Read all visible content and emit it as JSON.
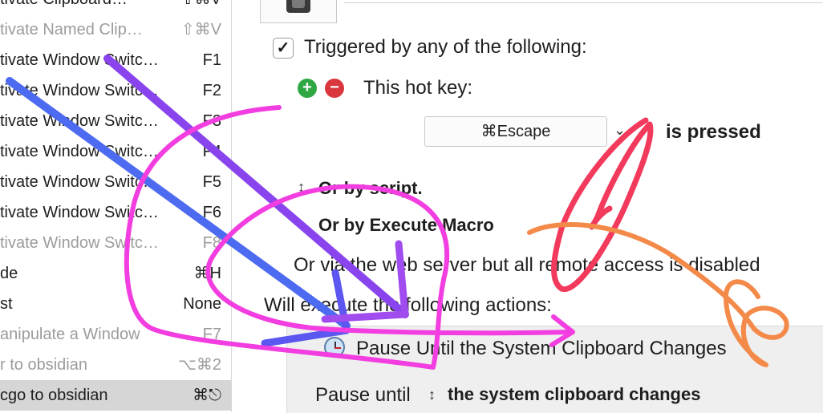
{
  "macro_list": {
    "items": [
      {
        "name": "tivate Clipboard…",
        "key": "⇧⌘V",
        "disabled": false
      },
      {
        "name": "tivate Named Clip…",
        "key": "⇧⌘V",
        "disabled": true
      },
      {
        "name": "tivate Window Switc…",
        "key": "F1",
        "disabled": false
      },
      {
        "name": "tivate Window Switc…",
        "key": "F2",
        "disabled": false
      },
      {
        "name": "tivate Window Switc…",
        "key": "F3",
        "disabled": false
      },
      {
        "name": "tivate Window Switc…",
        "key": "F4",
        "disabled": false
      },
      {
        "name": "tivate Window Switc…",
        "key": "F5",
        "disabled": false
      },
      {
        "name": "tivate Window Switc…",
        "key": "F6",
        "disabled": false
      },
      {
        "name": "tivate Window Switc…",
        "key": "F8",
        "disabled": true
      },
      {
        "name": "de",
        "key": "⌘H",
        "disabled": false
      },
      {
        "name": "st",
        "key": "None",
        "disabled": false
      },
      {
        "name": "anipulate a Window",
        "key": "F7",
        "disabled": true
      },
      {
        "name": "r to  obsidian",
        "key": "⌥⌘2",
        "disabled": true
      },
      {
        "name": "cgo to  obsidian",
        "key": "⌘⎋",
        "disabled": false,
        "selected": true
      }
    ]
  },
  "trigger": {
    "checkbox_checked": "✓",
    "label": "Triggered by any of the following:",
    "add_icon": "plus-circle-icon",
    "remove_icon": "minus-circle-icon",
    "hotkey_label": "This hot key:",
    "hotkey_value": "⌘Escape",
    "pressed_label": "is pressed",
    "or_script": "Or by script.",
    "or_execute_macro": "Or by Execute Macro",
    "web_server": "Or via the web server but all remote access is disabled"
  },
  "actions": {
    "heading": "Will execute the following actions:",
    "action_title": "Pause Until the System Clipboard Changes",
    "pause_until_label": "Pause until",
    "pause_until_value": "the system clipboard changes"
  },
  "colors": {
    "add_green": "#2fa844",
    "remove_red": "#d9363e",
    "selection_gray": "#d6d6d6",
    "annotation_pink": "#f23ee0",
    "annotation_purple": "#8a44ee",
    "annotation_blue": "#4d6bf0",
    "annotation_red": "#f23a5c",
    "annotation_orange": "#f48a4a"
  }
}
